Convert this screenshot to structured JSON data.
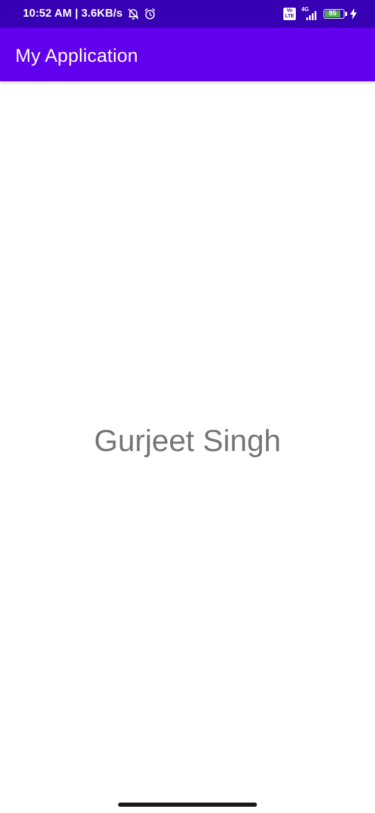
{
  "status_bar": {
    "time_speed": "10:52 AM | 3.6KB/s",
    "volte_top": "Vo",
    "volte_bottom": "LTE",
    "network_type": "4G",
    "battery_level": "85",
    "battery_percent": 85,
    "colors": {
      "background": "#3700B3",
      "battery_fill": "#4CAF50"
    },
    "icons": [
      "mute-bell-icon",
      "alarm-clock-icon",
      "signal-bars-icon",
      "charging-bolt-icon"
    ]
  },
  "app_bar": {
    "title": "My Application",
    "color": "#6200EE"
  },
  "main": {
    "text": "Gurjeet Singh",
    "text_color": "#757575"
  }
}
